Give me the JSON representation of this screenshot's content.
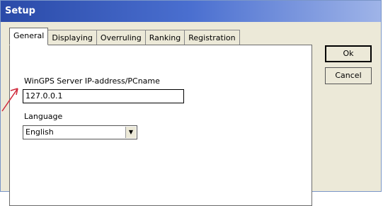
{
  "window": {
    "title": "Setup"
  },
  "tabs": [
    {
      "label": "General",
      "active": true
    },
    {
      "label": "Displaying",
      "active": false
    },
    {
      "label": "Overruling",
      "active": false
    },
    {
      "label": "Ranking",
      "active": false
    },
    {
      "label": "Registration",
      "active": false
    }
  ],
  "general": {
    "server_label": "WinGPS Server IP-address/PCname",
    "server_value": "127.0.0.1",
    "language_label": "Language",
    "language_value": "English"
  },
  "buttons": {
    "ok_label": "Ok",
    "cancel_label": "Cancel"
  },
  "colors": {
    "annotation_arrow": "#d0283a",
    "titlebar": "#2a4aa8"
  }
}
